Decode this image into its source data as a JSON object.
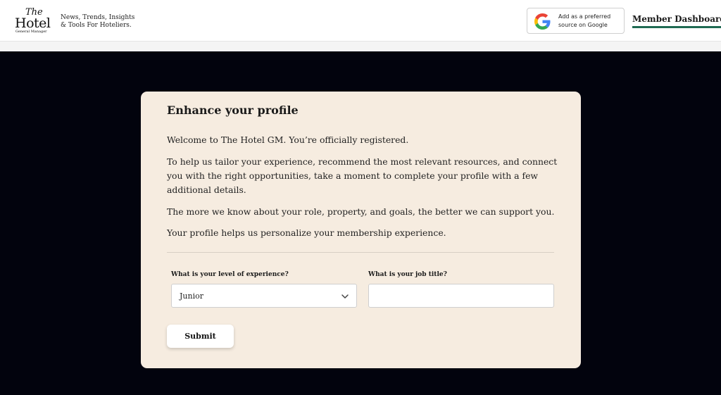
{
  "header": {
    "logo": {
      "the": "The",
      "hotel": "Hotel",
      "subtitle": "General Manager"
    },
    "tagline": {
      "line1": "News, Trends, Insights",
      "line2": "& Tools For Hoteliers."
    },
    "google_button": {
      "line1": "Add as a preferred",
      "line2": "source on Google",
      "icon": "google-g-icon"
    },
    "member_link": "Member Dashboard",
    "accent_color": "#1f6a52"
  },
  "profile_card": {
    "title": "Enhance your profile",
    "paragraphs": [
      "Welcome to The Hotel GM. You’re officially registered.",
      "To help us tailor your experience, recommend the most relevant resources, and connect you with the right opportunities, take a moment to complete your profile with a few additional details.",
      "The more we know about your role, property, and goals, the better we can support you.",
      "Your profile helps us personalize your membership experience."
    ],
    "experience": {
      "label": "What is your level of experience?",
      "selected": "Junior"
    },
    "job_title": {
      "label": "What is your job title?",
      "value": "",
      "placeholder": ""
    },
    "submit_label": "Submit",
    "background_color": "#f6ece0"
  }
}
